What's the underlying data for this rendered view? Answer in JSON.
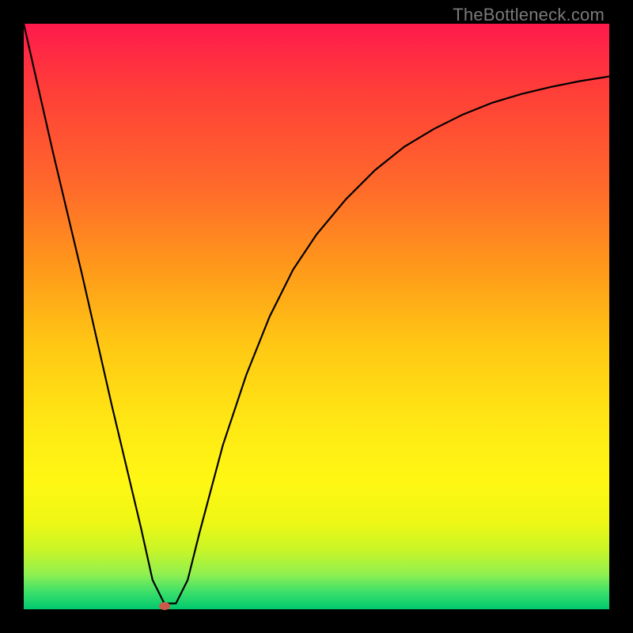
{
  "watermark": "TheBottleneck.com",
  "chart_data": {
    "type": "line",
    "title": "",
    "xlabel": "",
    "ylabel": "",
    "xlim": [
      0,
      100
    ],
    "ylim": [
      0,
      100
    ],
    "grid": false,
    "legend": false,
    "series": [
      {
        "name": "bottleneck-curve",
        "x": [
          0,
          5,
          10,
          15,
          20,
          22,
          24,
          26,
          28,
          30,
          34,
          38,
          42,
          46,
          50,
          55,
          60,
          65,
          70,
          75,
          80,
          85,
          90,
          95,
          100
        ],
        "y": [
          100,
          78,
          57,
          35,
          14,
          5,
          1,
          1,
          5,
          13,
          28,
          40,
          50,
          58,
          64,
          70,
          75,
          79,
          82,
          84.5,
          86.5,
          88,
          89.2,
          90.2,
          91
        ]
      }
    ],
    "marker": {
      "x": 24,
      "y": 0.5,
      "name": "optimal-point"
    },
    "gradient_stops": [
      {
        "pct": 0,
        "color": "#ff1a4d"
      },
      {
        "pct": 10,
        "color": "#ff3a3a"
      },
      {
        "pct": 28,
        "color": "#ff6a2a"
      },
      {
        "pct": 42,
        "color": "#ff9a1a"
      },
      {
        "pct": 55,
        "color": "#ffc814"
      },
      {
        "pct": 68,
        "color": "#ffe714"
      },
      {
        "pct": 78,
        "color": "#fff714"
      },
      {
        "pct": 85,
        "color": "#eff714"
      },
      {
        "pct": 90,
        "color": "#c8f528"
      },
      {
        "pct": 94,
        "color": "#90f050"
      },
      {
        "pct": 97,
        "color": "#3de06a"
      },
      {
        "pct": 100,
        "color": "#00c96e"
      }
    ]
  }
}
